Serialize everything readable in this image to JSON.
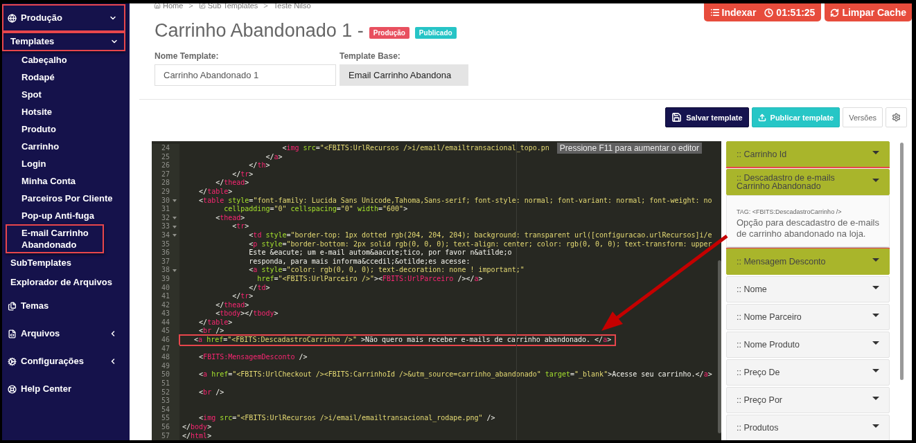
{
  "sidebar": {
    "items": [
      {
        "label": "Produção",
        "kind": "group",
        "expanded": true,
        "annotated": true,
        "children": [
          {
            "label": "Templates",
            "kind": "group",
            "expanded": true,
            "annotated": true,
            "children": [
              {
                "label": "Cabeçalho",
                "kind": "link",
                "annotated": false
              },
              {
                "label": "Rodapé",
                "kind": "link",
                "annotated": false
              },
              {
                "label": "Spot",
                "kind": "link",
                "annotated": false
              },
              {
                "label": "Hotsite",
                "kind": "link",
                "annotated": false
              },
              {
                "label": "Produto",
                "kind": "link",
                "annotated": false
              },
              {
                "label": "Carrinho",
                "kind": "link",
                "annotated": false
              },
              {
                "label": "Login",
                "kind": "link",
                "annotated": false
              },
              {
                "label": "Minha Conta",
                "kind": "link",
                "annotated": false
              },
              {
                "label": "Parceiros Por Cliente",
                "kind": "link",
                "annotated": false
              },
              {
                "label": "Pop-up Anti-fuga",
                "kind": "link",
                "annotated": false
              },
              {
                "label": "E-mail Carrinho Abandonado",
                "kind": "link",
                "annotated": true
              }
            ]
          },
          {
            "label": "SubTemplates",
            "kind": "link",
            "annotated": false
          },
          {
            "label": "Explorador de Arquivos",
            "kind": "link",
            "annotated": false
          }
        ]
      },
      {
        "label": "Temas",
        "kind": "link",
        "annotated": false
      },
      {
        "label": "Arquivos",
        "kind": "group",
        "expanded": false,
        "annotated": false
      },
      {
        "label": "Configurações",
        "kind": "group",
        "expanded": false,
        "annotated": false
      },
      {
        "label": "Help Center",
        "kind": "link",
        "annotated": false
      }
    ]
  },
  "breadcrumb": [
    {
      "label": "Home"
    },
    {
      "separator": ">",
      "label": "Sub Templates"
    },
    {
      "separator": ">",
      "label": "Teste Nilso"
    }
  ],
  "top_actions": {
    "index_button": "Indexar",
    "timer": "01:51:25",
    "clear_cache_button": "Limpar Cache"
  },
  "title": "Carrinho Abandonado 1 -",
  "badges": [
    {
      "label": "Produção",
      "color": "#e8505f"
    },
    {
      "label": "Publicado",
      "color": "#26c4c6"
    }
  ],
  "form": {
    "name_label": "Nome Template:",
    "name_value": "Carrinho Abandonado 1",
    "base_label": "Template Base:",
    "base_value": "Email Carrinho Abandona",
    "base_disabled": true
  },
  "toolbar": {
    "save": "Salvar template",
    "publish": "Publicar template",
    "versions": "Versões"
  },
  "editor": {
    "hint": "Pressione F11 para aumentar o editor",
    "lines": [
      {
        "n": "24",
        "fold": false,
        "annotated": false,
        "tokens": [
          {
            "kind": "plain",
            "text": "                        <"
          },
          {
            "kind": "tag",
            "text": "img"
          },
          {
            "kind": "attr",
            "text": " src"
          },
          {
            "kind": "plain",
            "text": "="
          },
          {
            "kind": "string",
            "text": "\"<FBITS:UrlRecursos />i/email/emailtransacional_topo.pn"
          }
        ]
      },
      {
        "n": "25",
        "fold": false,
        "annotated": false,
        "tokens": [
          {
            "kind": "plain",
            "text": "                    </"
          },
          {
            "kind": "tag",
            "text": "a"
          },
          {
            "kind": "plain",
            "text": ">"
          }
        ]
      },
      {
        "n": "26",
        "fold": false,
        "annotated": false,
        "tokens": [
          {
            "kind": "plain",
            "text": "                </"
          },
          {
            "kind": "tag",
            "text": "th"
          },
          {
            "kind": "plain",
            "text": ">"
          }
        ]
      },
      {
        "n": "27",
        "fold": false,
        "annotated": false,
        "tokens": [
          {
            "kind": "plain",
            "text": "            </"
          },
          {
            "kind": "tag",
            "text": "tr"
          },
          {
            "kind": "plain",
            "text": ">"
          }
        ]
      },
      {
        "n": "28",
        "fold": false,
        "annotated": false,
        "tokens": [
          {
            "kind": "plain",
            "text": "        </"
          },
          {
            "kind": "tag",
            "text": "thead"
          },
          {
            "kind": "plain",
            "text": ">"
          }
        ]
      },
      {
        "n": "29",
        "fold": false,
        "annotated": false,
        "tokens": [
          {
            "kind": "plain",
            "text": "    </"
          },
          {
            "kind": "tag",
            "text": "table"
          },
          {
            "kind": "plain",
            "text": ">"
          }
        ]
      },
      {
        "n": "30",
        "fold": true,
        "annotated": false,
        "tokens": [
          {
            "kind": "plain",
            "text": "    <"
          },
          {
            "kind": "tag",
            "text": "table"
          },
          {
            "kind": "attr",
            "text": " style"
          },
          {
            "kind": "plain",
            "text": "="
          },
          {
            "kind": "string",
            "text": "\"font-family: Lucida Sans Unicode,Tahoma,Sans-serif; font-style: normal; font-variant: normal; font-weight: no"
          }
        ]
      },
      {
        "n": "31",
        "fold": false,
        "annotated": false,
        "tokens": [
          {
            "kind": "attr",
            "text": "          cellpadding"
          },
          {
            "kind": "plain",
            "text": "="
          },
          {
            "kind": "string",
            "text": "\"0\""
          },
          {
            "kind": "attr",
            "text": " cellspacing"
          },
          {
            "kind": "plain",
            "text": "="
          },
          {
            "kind": "string",
            "text": "\"0\""
          },
          {
            "kind": "attr",
            "text": " width"
          },
          {
            "kind": "plain",
            "text": "="
          },
          {
            "kind": "string",
            "text": "\"600\""
          },
          {
            "kind": "plain",
            "text": ">"
          }
        ]
      },
      {
        "n": "32",
        "fold": true,
        "annotated": false,
        "tokens": [
          {
            "kind": "plain",
            "text": "        <"
          },
          {
            "kind": "tag",
            "text": "thead"
          },
          {
            "kind": "plain",
            "text": ">"
          }
        ]
      },
      {
        "n": "33",
        "fold": true,
        "annotated": false,
        "tokens": [
          {
            "kind": "plain",
            "text": "            <"
          },
          {
            "kind": "tag",
            "text": "tr"
          },
          {
            "kind": "plain",
            "text": ">"
          }
        ]
      },
      {
        "n": "34",
        "fold": true,
        "annotated": false,
        "tokens": [
          {
            "kind": "plain",
            "text": "                <"
          },
          {
            "kind": "tag",
            "text": "td"
          },
          {
            "kind": "attr",
            "text": " style"
          },
          {
            "kind": "plain",
            "text": "="
          },
          {
            "kind": "string",
            "text": "\"border-top: 1px dotted rgb(204, 204, 204); background: transparent url([configuracao.urlRecursos]i/e"
          }
        ]
      },
      {
        "n": "35",
        "fold": false,
        "annotated": false,
        "tokens": [
          {
            "kind": "plain",
            "text": "                <"
          },
          {
            "kind": "tag",
            "text": "p"
          },
          {
            "kind": "attr",
            "text": " style"
          },
          {
            "kind": "plain",
            "text": "="
          },
          {
            "kind": "string",
            "text": "\"border-bottom: 2px solid rgb(0, 0, 0); text-align: center; color: rgb(0, 0, 0); text-transform: upper"
          }
        ]
      },
      {
        "n": "36",
        "fold": false,
        "annotated": false,
        "tokens": [
          {
            "kind": "plain",
            "text": "                Este &eacute; um e-mail autom&aacute;tico, por favor n&atilde;o"
          }
        ]
      },
      {
        "n": "37",
        "fold": false,
        "annotated": false,
        "tokens": [
          {
            "kind": "plain",
            "text": "                responda, para mais informa&ccedil;&otilde;es acesse:"
          }
        ]
      },
      {
        "n": "38",
        "fold": true,
        "annotated": false,
        "tokens": [
          {
            "kind": "plain",
            "text": "                <"
          },
          {
            "kind": "tag",
            "text": "a"
          },
          {
            "kind": "attr",
            "text": " style"
          },
          {
            "kind": "plain",
            "text": "="
          },
          {
            "kind": "string",
            "text": "\"color: rgb(0, 0, 0); text-decoration: none ! important;\""
          }
        ]
      },
      {
        "n": "39",
        "fold": false,
        "annotated": false,
        "tokens": [
          {
            "kind": "attr",
            "text": "                  href"
          },
          {
            "kind": "plain",
            "text": "="
          },
          {
            "kind": "string",
            "text": "\"<FBITS:UrlParceiro />\""
          },
          {
            "kind": "plain",
            "text": "><"
          },
          {
            "kind": "tag",
            "text": "FBITS:UrlParceiro"
          },
          {
            "kind": "plain",
            "text": " /></"
          },
          {
            "kind": "tag",
            "text": "a"
          },
          {
            "kind": "plain",
            "text": ">"
          }
        ]
      },
      {
        "n": "40",
        "fold": false,
        "annotated": false,
        "tokens": [
          {
            "kind": "plain",
            "text": "                </"
          },
          {
            "kind": "tag",
            "text": "td"
          },
          {
            "kind": "plain",
            "text": ">"
          }
        ]
      },
      {
        "n": "41",
        "fold": false,
        "annotated": false,
        "tokens": [
          {
            "kind": "plain",
            "text": "            </"
          },
          {
            "kind": "tag",
            "text": "tr"
          },
          {
            "kind": "plain",
            "text": ">"
          }
        ]
      },
      {
        "n": "42",
        "fold": false,
        "annotated": false,
        "tokens": [
          {
            "kind": "plain",
            "text": "        </"
          },
          {
            "kind": "tag",
            "text": "thead"
          },
          {
            "kind": "plain",
            "text": ">"
          }
        ]
      },
      {
        "n": "43",
        "fold": false,
        "annotated": false,
        "tokens": [
          {
            "kind": "plain",
            "text": "        <"
          },
          {
            "kind": "tag",
            "text": "tbody"
          },
          {
            "kind": "plain",
            "text": "></"
          },
          {
            "kind": "tag",
            "text": "tbody"
          },
          {
            "kind": "plain",
            "text": ">"
          }
        ]
      },
      {
        "n": "44",
        "fold": false,
        "annotated": false,
        "tokens": [
          {
            "kind": "plain",
            "text": "    </"
          },
          {
            "kind": "tag",
            "text": "table"
          },
          {
            "kind": "plain",
            "text": ">"
          }
        ]
      },
      {
        "n": "45",
        "fold": false,
        "annotated": false,
        "tokens": [
          {
            "kind": "plain",
            "text": "    <"
          },
          {
            "kind": "tag",
            "text": "br"
          },
          {
            "kind": "plain",
            "text": " />"
          }
        ]
      },
      {
        "n": "46",
        "fold": false,
        "annotated": true,
        "tokens": [
          {
            "kind": "plain",
            "text": "   <"
          },
          {
            "kind": "tag",
            "text": "a"
          },
          {
            "kind": "attr",
            "text": " href"
          },
          {
            "kind": "plain",
            "text": "="
          },
          {
            "kind": "string",
            "text": "\"<FBITS:DescadastroCarrinho />\""
          },
          {
            "kind": "plain",
            "text": " >Não quero mais receber e-mails de carrinho abandonado. </"
          },
          {
            "kind": "tag",
            "text": "a"
          },
          {
            "kind": "plain",
            "text": ">"
          }
        ]
      },
      {
        "n": "47",
        "fold": false
      },
      {
        "n": "48",
        "fold": false,
        "annotated": false,
        "tokens": [
          {
            "kind": "plain",
            "text": "    <"
          },
          {
            "kind": "tag",
            "text": "FBITS:MensagemDesconto"
          },
          {
            "kind": "plain",
            "text": " />"
          }
        ]
      },
      {
        "n": "49",
        "fold": false
      },
      {
        "n": "50",
        "fold": false,
        "annotated": false,
        "tokens": [
          {
            "kind": "plain",
            "text": "    <"
          },
          {
            "kind": "tag",
            "text": "a"
          },
          {
            "kind": "attr",
            "text": " href"
          },
          {
            "kind": "plain",
            "text": "="
          },
          {
            "kind": "string",
            "text": "\"<FBITS:UrlCheckout /><FBITS:CarrinhoId />&utm_source=carrinho_abandonado\""
          },
          {
            "kind": "attr",
            "text": " target"
          },
          {
            "kind": "plain",
            "text": "="
          },
          {
            "kind": "string",
            "text": "\"_blank\""
          },
          {
            "kind": "plain",
            "text": ">Acesse seu carrinho.</"
          },
          {
            "kind": "tag",
            "text": "a"
          },
          {
            "kind": "plain",
            "text": ">"
          }
        ]
      },
      {
        "n": "51",
        "fold": false
      },
      {
        "n": "52",
        "fold": false,
        "annotated": false,
        "tokens": [
          {
            "kind": "plain",
            "text": "    <"
          },
          {
            "kind": "tag",
            "text": "br"
          },
          {
            "kind": "plain",
            "text": " />"
          }
        ]
      },
      {
        "n": "53",
        "fold": false
      },
      {
        "n": "54",
        "fold": false
      },
      {
        "n": "55",
        "fold": false,
        "annotated": false,
        "tokens": [
          {
            "kind": "plain",
            "text": "    <"
          },
          {
            "kind": "tag",
            "text": "img"
          },
          {
            "kind": "attr",
            "text": " src"
          },
          {
            "kind": "plain",
            "text": "="
          },
          {
            "kind": "string",
            "text": "\"<FBITS:UrlRecursos />i/email/emailtransacional_rodape.png\""
          },
          {
            "kind": "plain",
            "text": " />"
          }
        ]
      },
      {
        "n": "56",
        "fold": false,
        "annotated": false,
        "tokens": [
          {
            "kind": "plain",
            "text": "</"
          },
          {
            "kind": "tag",
            "text": "body"
          },
          {
            "kind": "plain",
            "text": ">"
          }
        ]
      },
      {
        "n": "57",
        "fold": false,
        "annotated": false,
        "tokens": [
          {
            "kind": "plain",
            "text": "</"
          },
          {
            "kind": "tag",
            "text": "html"
          },
          {
            "kind": "plain",
            "text": ">"
          }
        ]
      }
    ]
  },
  "tags_panel": {
    "items": [
      {
        "label": ":: Carrinho Id",
        "color": "#a9b52b",
        "expanded": false,
        "annotated": false
      },
      {
        "label": ":: Descadastro de e-mails Carrinho Abandonado",
        "color": "#a9b52b",
        "expanded": true,
        "annotated": true,
        "tag": "TAG: <FBITS:DescadastroCarrinho />",
        "description": "Opção para descadastro de e-mails de carrinho abandonado na loja."
      },
      {
        "label": ":: Mensagem Desconto",
        "color": "#a9b52b",
        "expanded": false,
        "annotated": false
      },
      {
        "label": ":: Nome",
        "color": "#f4f4f4",
        "expanded": false,
        "annotated": false
      },
      {
        "label": ":: Nome Parceiro",
        "color": "#f4f4f4",
        "expanded": false,
        "annotated": false
      },
      {
        "label": ":: Nome Produto",
        "color": "#f4f4f4",
        "expanded": false,
        "annotated": false
      },
      {
        "label": ":: Preço De",
        "color": "#f4f4f4",
        "expanded": false,
        "annotated": false
      },
      {
        "label": ":: Preço Por",
        "color": "#f4f4f4",
        "expanded": false,
        "annotated": false
      },
      {
        "label": ":: Produtos",
        "color": "#f4f4f4",
        "expanded": false,
        "annotated": false
      }
    ]
  }
}
